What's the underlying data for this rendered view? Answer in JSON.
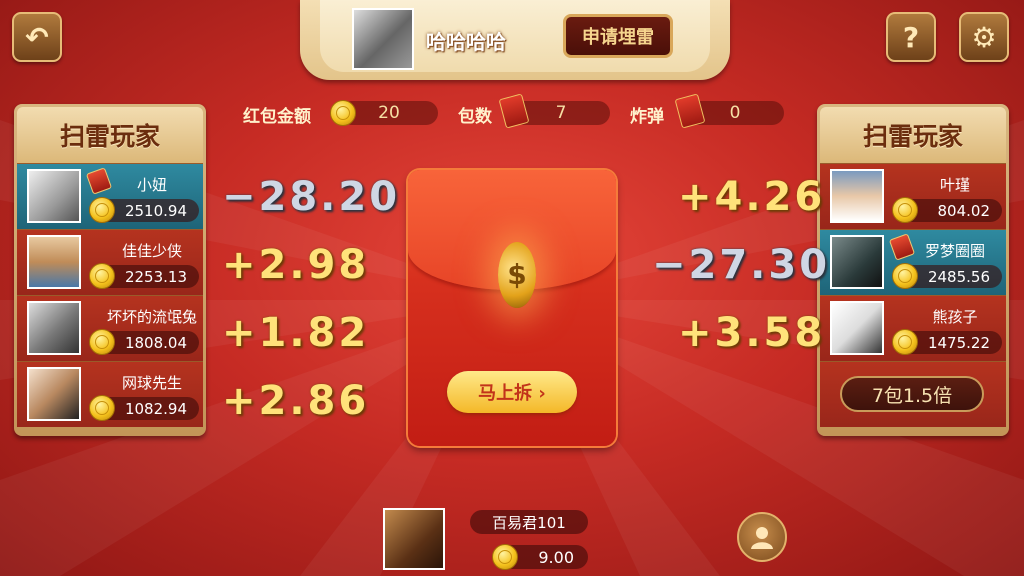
{
  "header": {
    "host_name": "哈哈哈哈",
    "apply_button": "申请埋雷",
    "help_glyph": "?",
    "settings_glyph": "⚙",
    "back_glyph": "↶"
  },
  "stats": {
    "amount_label": "红包金额",
    "amount_value": "20",
    "count_label": "包数",
    "count_value": "7",
    "bomb_label": "炸弹",
    "bomb_value": "0"
  },
  "left_panel": {
    "title": "扫雷玩家",
    "players": [
      {
        "name": "小妞",
        "balance": "2510.94",
        "result": "−28.20"
      },
      {
        "name": "佳佳少侠",
        "balance": "2253.13",
        "result": "+2.98"
      },
      {
        "name": "坏坏的流氓兔",
        "balance": "1808.04",
        "result": "+1.82"
      },
      {
        "name": "网球先生",
        "balance": "1082.94",
        "result": "+2.86"
      }
    ]
  },
  "right_panel": {
    "title": "扫雷玩家",
    "players": [
      {
        "name": "叶瑾",
        "balance": "804.02",
        "result": "+4.26"
      },
      {
        "name": "罗梦圈圈",
        "balance": "2485.56",
        "result": "−27.30"
      },
      {
        "name": "熊孩子",
        "balance": "1475.22",
        "result": "+3.58"
      }
    ],
    "multiplier_button": "7包1.5倍"
  },
  "envelope": {
    "coin_symbol": "$",
    "open_button": "马上拆 ›"
  },
  "me": {
    "name": "百易君101",
    "balance": "9.00"
  },
  "colors": {
    "background": "#c62b24",
    "panel": "#d8b680",
    "gold": "#f4b828",
    "highlight_row": "#2f8aa0"
  }
}
